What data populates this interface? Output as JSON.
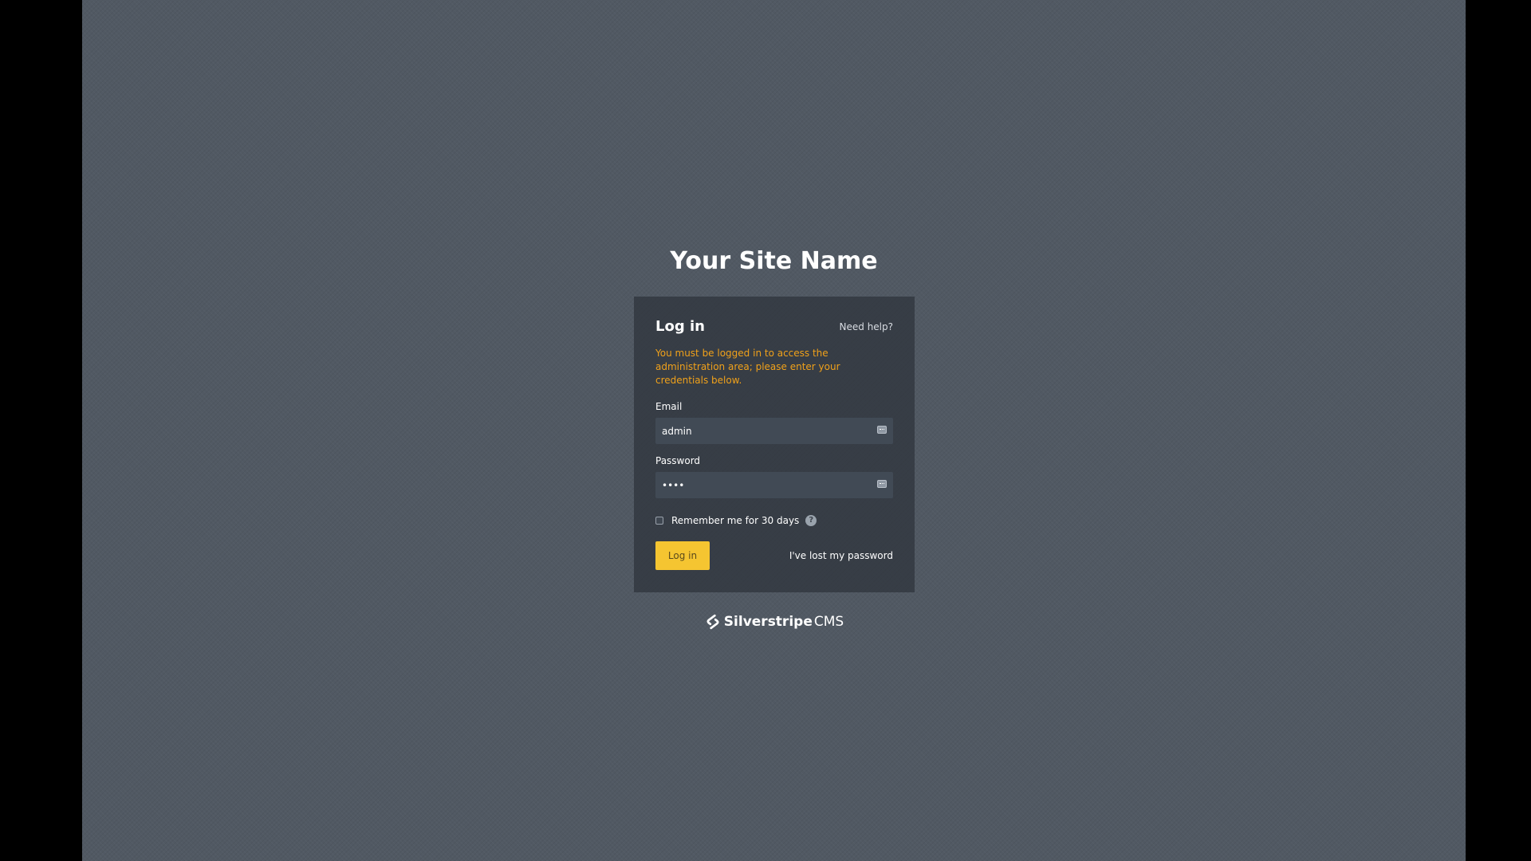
{
  "site": {
    "title": "Your Site Name"
  },
  "login": {
    "title": "Log in",
    "help_link": "Need help?",
    "notice": "You must be logged in to access the administration area; please enter your credentials below.",
    "email": {
      "label": "Email",
      "value": "admin",
      "icon": "password-manager-icon"
    },
    "password": {
      "label": "Password",
      "value": "••••",
      "icon": "password-manager-icon"
    },
    "remember": {
      "label": "Remember me for 30 days",
      "checked": false,
      "help_icon": "?"
    },
    "submit_label": "Log in",
    "lost_password_link": "I've lost my password"
  },
  "brand": {
    "name": "Silverstripe",
    "suffix": "CMS",
    "logo_icon": "silverstripe-logo-icon"
  },
  "colors": {
    "background": "#515963",
    "card": "#30363d",
    "notice": "#f0a11a",
    "button": "#f5c531",
    "letterbox": "#000000"
  }
}
